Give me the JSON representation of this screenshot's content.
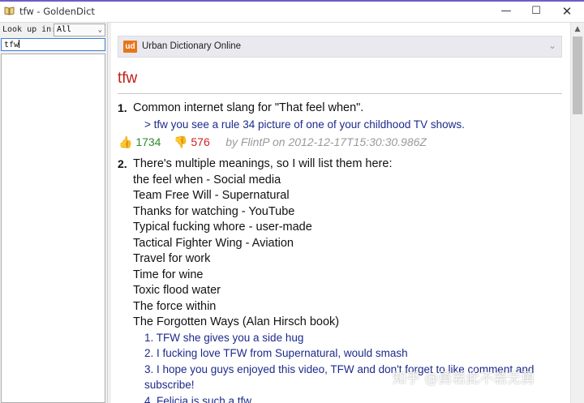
{
  "window": {
    "title": "tfw - GoldenDict",
    "minimize_glyph": "—",
    "maximize_glyph": "☐",
    "close_glyph": "✕"
  },
  "left_panel": {
    "lookup_label": "Look up in:",
    "lookup_value": "All",
    "search_value": "tfw"
  },
  "article": {
    "dictionary_name": "Urban Dictionary Online",
    "dictionary_icon_text": "ud",
    "headword": "tfw",
    "definitions": [
      {
        "number": "1.",
        "text": "Common internet slang for \"That feel when\".",
        "example": "> tfw you see a rule 34 picture of one of your childhood TV shows.",
        "upvotes": "1734",
        "downvotes": "576",
        "author": "by FlintP on 2012-12-17T15:30:30.986Z"
      },
      {
        "number": "2.",
        "lines": [
          "There's multiple meanings, so I will list them here:",
          "the feel when - Social media",
          "Team Free Will - Supernatural",
          "Thanks for watching - YouTube",
          "Typical fucking whore - user-made",
          "Tactical Fighter Wing - Aviation",
          "Travel for work",
          "Time for wine",
          "Toxic flood water",
          "The force within",
          "The Forgotten Ways (Alan Hirsch book)"
        ],
        "examples": [
          "1. TFW she gives you a side hug",
          "2. I fucking love TFW from Supernatural, would smash",
          "3. I hope you guys enjoyed this video, TFW and don't forget to like comment and",
          "subscribe!",
          "4. Felicia is such a tfw"
        ]
      }
    ]
  },
  "watermark": "知乎 @勇若此不若无勇",
  "colors": {
    "headword": "#c02018",
    "example_link": "#1c2b8c",
    "upvote": "#2e8b2e",
    "downvote": "#cc2222",
    "dictionary_icon": "#e8751a"
  }
}
